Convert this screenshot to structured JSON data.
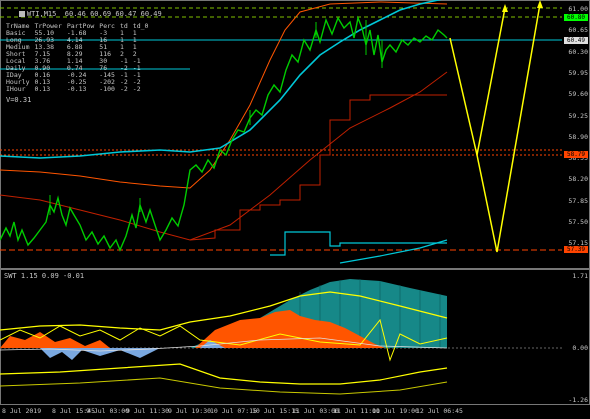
{
  "main": {
    "title": "WTI,M15  60.46 60.69 60.47 60.49",
    "table_headers": [
      "TrName",
      "TrPower",
      "PartPow",
      "Perc",
      "td",
      "td_0"
    ],
    "table_rows": [
      [
        "Basic",
        "55.10",
        "-1.68",
        "-3",
        "1",
        "1"
      ],
      [
        "Long",
        "26.93",
        "4.14",
        "16",
        "1",
        "1"
      ],
      [
        "Medium",
        "13.38",
        "6.88",
        "51",
        "1",
        "1"
      ],
      [
        "Short",
        "7.15",
        "8.29",
        "116",
        "2",
        "2"
      ],
      [
        "Local",
        "3.76",
        "1.14",
        "30",
        "-1",
        "-1"
      ],
      [
        "Daily",
        "0.90",
        "0.74",
        "76",
        "-2",
        "-1"
      ],
      [
        "IDay",
        "0.16",
        "-0.24",
        "-145",
        "-1",
        "-1"
      ],
      [
        "Hourly",
        "0.13",
        "-0.25",
        "-202",
        "-2",
        "-2"
      ],
      [
        "IHour",
        "0.13",
        "-0.13",
        "-100",
        "-2",
        "-2"
      ]
    ],
    "footer_text": "V=0.31",
    "y_axis_labels": [
      "61.00",
      "60.65",
      "60.30",
      "59.95",
      "59.60",
      "59.25",
      "58.90",
      "58.55",
      "58.20",
      "57.85",
      "57.50",
      "57.15"
    ],
    "price_tags": [
      {
        "text": "60.80",
        "color": "#00ff00"
      },
      {
        "text": "60.49",
        "color": "#e0e0e0"
      },
      {
        "text": "58.79",
        "color": "#ff4400"
      },
      {
        "text": "57.39",
        "color": "#ff4400"
      }
    ]
  },
  "oscillator": {
    "title": "SWT 1.15 0.09 -0.01",
    "y_axis_labels": [
      "1.71",
      "0.00",
      "-1.26"
    ]
  },
  "x_axis_labels": [
    "8 Jul 2019",
    "8 Jul 15:45",
    "9 Jul 03:00",
    "9 Jul 11:30",
    "9 Jul 19:30",
    "10 Jul 07:15",
    "10 Jul 15:15",
    "11 Jul 03:00",
    "11 Jul 11:00",
    "11 Jul 19:00",
    "12 Jul 06:45"
  ],
  "colors": {
    "background": "#000000",
    "candles": "#00cc00",
    "cyan_line": "#00c8d8",
    "orange_line": "#ff5500",
    "red_line": "#c02000",
    "yellow": "#ffff00",
    "level_green_dashed": "#80c000",
    "level_red_dashed": "#ff4400",
    "histogram_teal": "#1aa0a0",
    "histogram_orange": "#ff5500",
    "histogram_blue": "#7aa8e0"
  }
}
